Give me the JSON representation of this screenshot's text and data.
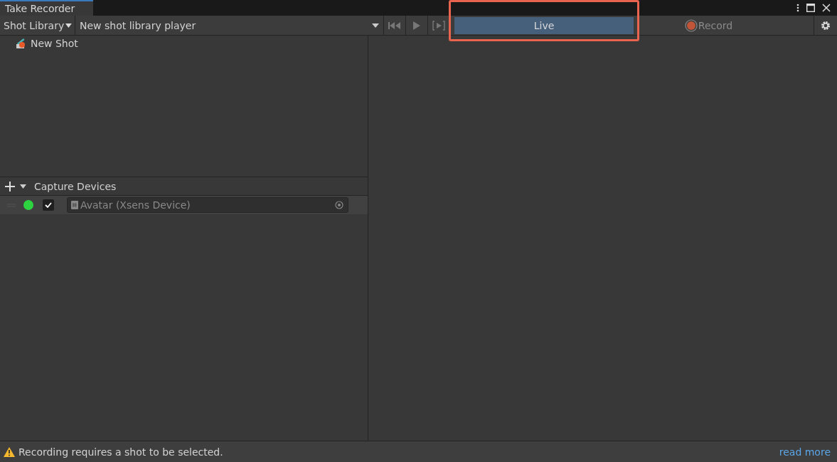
{
  "window": {
    "tab": "Take Recorder"
  },
  "toolbar": {
    "library_menu": "Shot Library",
    "player_dropdown": "New shot library player",
    "mode": {
      "label": "Live",
      "selected": true,
      "highlighted": true
    },
    "record": {
      "label": "Record",
      "recording": false
    }
  },
  "shots": [
    {
      "name": "New Shot",
      "selected": false
    }
  ],
  "capture_devices": {
    "title": "Capture Devices",
    "expanded": true,
    "devices": [
      {
        "name": "Avatar (Xsens Device)",
        "connected": true,
        "enabled": true
      }
    ]
  },
  "status_bar": {
    "message": "Recording requires a shot to be selected.",
    "link": "read more"
  }
}
